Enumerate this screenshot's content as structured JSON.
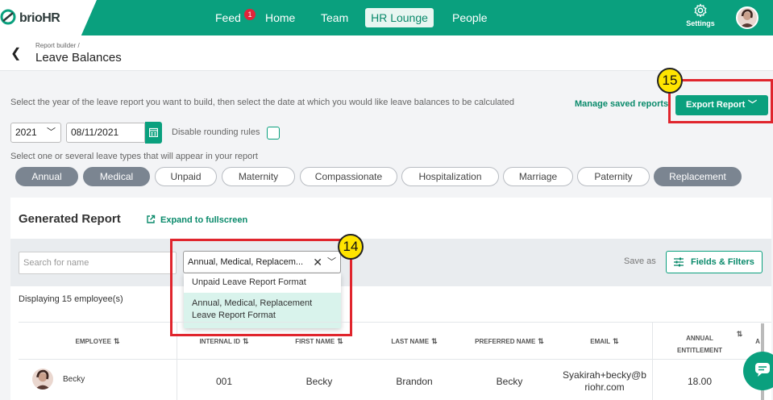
{
  "app": {
    "logo_main": "brio",
    "logo_suffix": "HR"
  },
  "nav": {
    "feed": "Feed",
    "feed_badge": "1",
    "home": "Home",
    "team": "Team",
    "hr_lounge": "HR Lounge",
    "people": "People",
    "settings": "Settings"
  },
  "header": {
    "breadcrumb": "Report builder /",
    "title": "Leave Balances"
  },
  "instructions": "Select the year of the leave report you want to build, then select the date at which you would like leave balances to be calculated",
  "actions": {
    "manage_saved": "Manage saved reports",
    "export": "Export Report"
  },
  "callouts": {
    "export": "15",
    "format": "14"
  },
  "controls": {
    "year": "2021",
    "date": "08/11/2021",
    "disable_rounding": "Disable rounding rules",
    "leave_types_label": "Select one or several leave types that will appear in your report"
  },
  "leave_types": [
    {
      "label": "Annual",
      "selected": true
    },
    {
      "label": "Medical",
      "selected": true
    },
    {
      "label": "Unpaid",
      "selected": false
    },
    {
      "label": "Maternity",
      "selected": false
    },
    {
      "label": "Compassionate",
      "selected": false
    },
    {
      "label": "Hospitalization",
      "selected": false
    },
    {
      "label": "Marriage",
      "selected": false
    },
    {
      "label": "Paternity",
      "selected": false
    },
    {
      "label": "Replacement",
      "selected": true
    }
  ],
  "report": {
    "title": "Generated Report",
    "expand": "Expand to fullscreen",
    "search_placeholder": "Search for name",
    "format_value": "Annual, Medical, Replacem...",
    "save_as": "Save as",
    "fields_filters": "Fields & Filters",
    "format_options": [
      "Unpaid Leave Report Format",
      "Annual, Medical, Replacement",
      "Leave Report Format"
    ],
    "displaying": "Displaying 15 employee(s)"
  },
  "table": {
    "headers": {
      "employee": "EMPLOYEE",
      "internal_id": "INTERNAL ID",
      "first_name": "FIRST NAME",
      "last_name": "LAST NAME",
      "preferred_name": "PREFERRED NAME",
      "email": "EMAIL",
      "annual_1": "ANNUAL",
      "annual_2": "ENTITLEMENT",
      "next": "A"
    },
    "row": {
      "employee": "Becky",
      "internal_id": "001",
      "first_name": "Becky",
      "last_name": "Brandon",
      "preferred_name": "Becky",
      "email_1": "Syakirah+becky@b",
      "email_2": "riohr.com",
      "annual": "18.00"
    }
  }
}
